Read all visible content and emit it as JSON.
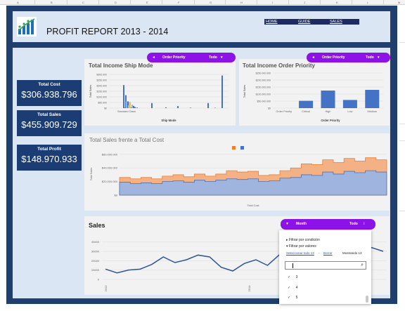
{
  "sheet": {
    "column_letters": [
      "A",
      "B",
      "C",
      "D",
      "E",
      "F",
      "G",
      "H",
      "I",
      "J",
      "K",
      "L",
      "M"
    ]
  },
  "header": {
    "title": "PROFIT REPORT 2013 - 2014",
    "nav": [
      "HOME",
      "GUIDE",
      "SALES"
    ]
  },
  "kpis": [
    {
      "label": "Total Cost",
      "value": "$306.938.796"
    },
    {
      "label": "Total Sales",
      "value": "$455.909.729"
    },
    {
      "label": "Total Profit",
      "value": "$148.970.933"
    }
  ],
  "filters": {
    "ship_mode_filter": {
      "label": "Order Priority",
      "value": "Todo"
    },
    "order_priority_filter": {
      "label": "Order Priority",
      "value": "Todo"
    },
    "month_filter": {
      "label": "Month",
      "value": "Todo"
    }
  },
  "colors": {
    "frame": "#1f3f6e",
    "panel": "#dbe6f4",
    "kpi": "#1b3d74",
    "pill": "#8c12e8",
    "bar_blue": "#4472c4",
    "bar_light_blue": "#8eb3dc",
    "bar_yellow": "#f4c430",
    "area_orange": "#f4b183",
    "area_blue": "#9fb5dd",
    "line_blue": "#2e5597"
  },
  "chart_data": [
    {
      "type": "bar",
      "title": "Total Income Ship Mode",
      "xlabel": "Ship Mode",
      "ylabel": "Total Sales",
      "x_tick_labels": [
        "Standard Class"
      ],
      "y_tick_labels": [
        "$0",
        "$50.000",
        "$100.000",
        "$150.000",
        "$200.000",
        "$250.000",
        "$300.000"
      ],
      "ylim": [
        0,
        300000
      ],
      "series": [
        {
          "color": "#4472c4",
          "values": [
            205000,
            5000,
            115000,
            60000,
            8000,
            7000,
            6000,
            20000,
            10000,
            5000,
            45000,
            7000,
            18000,
            4000,
            45000,
            3000,
            290000
          ]
        },
        {
          "color": "#8eb3dc",
          "values": [
            60000,
            25000,
            30000
          ]
        },
        {
          "color": "#f4c430",
          "values": [
            55000
          ]
        }
      ]
    },
    {
      "type": "bar",
      "title": "Total Income Order Priority",
      "xlabel": "Order Priority",
      "ylabel": "Total Sales",
      "categories": [
        "Order Priority",
        "Critical",
        "High",
        "Low",
        "Medium"
      ],
      "values": [
        0,
        52000000,
        125000000,
        58000000,
        130000000
      ],
      "y_tick_labels": [
        "$0",
        "$50.000.000",
        "$100.000.000",
        "$150.000.000",
        "$200.000.000",
        "$250.000.000"
      ],
      "ylim": [
        0,
        250000000
      ]
    },
    {
      "type": "area",
      "title": "Total Sales frente a Total Cost",
      "xlabel": "Total Cost",
      "ylabel": "Total Sales",
      "y_tick_labels": [
        "$0",
        "$20.000.000",
        "$40.000.000",
        "$60.000.000"
      ],
      "ylim": [
        0,
        65000000
      ],
      "legend_colors": [
        "#ed7d31",
        "#4472c4"
      ],
      "series": [
        {
          "color": "#f4b183",
          "values": [
            26000000,
            24000000,
            26000000,
            24000000,
            28000000,
            30000000,
            27000000,
            31000000,
            28000000,
            31000000,
            36000000,
            34000000,
            35000000,
            29000000,
            30000000,
            36000000,
            40000000,
            46000000,
            45000000,
            52000000,
            48000000,
            54000000,
            50000000,
            55000000,
            52000000
          ]
        },
        {
          "color": "#9fb5dd",
          "values": [
            19000000,
            17000000,
            18000000,
            17000000,
            20000000,
            21000000,
            19000000,
            22000000,
            20000000,
            22000000,
            24000000,
            23000000,
            24000000,
            20000000,
            21000000,
            25000000,
            26000000,
            30000000,
            29000000,
            34000000,
            31000000,
            35000000,
            33000000,
            36000000,
            34000000
          ]
        }
      ]
    },
    {
      "type": "line",
      "title": "Sales",
      "y_tick_labels": [
        "0",
        "10000",
        "20000",
        "30000",
        "40000"
      ],
      "ylim": [
        0,
        42000
      ],
      "x_tick_labels": [
        "2013",
        "2014"
      ],
      "values": [
        11000,
        7000,
        10000,
        11000,
        16000,
        24000,
        18000,
        21000,
        26000,
        24000,
        13000,
        9000,
        17000,
        21000,
        15000,
        26000,
        19000,
        23000,
        29000,
        27000,
        33000,
        29000,
        31000,
        34000,
        30000
      ]
    }
  ],
  "dropdown": {
    "filter_by_condition": "Filtrar por condición",
    "filter_by_values": "Filtrar por valores",
    "select_all": "Seleccionar todo 13",
    "separator": " - ",
    "clear": "Borrar",
    "showing": "Mostrando 13",
    "items": [
      "3",
      "4",
      "5"
    ],
    "checkmark": "✓"
  }
}
